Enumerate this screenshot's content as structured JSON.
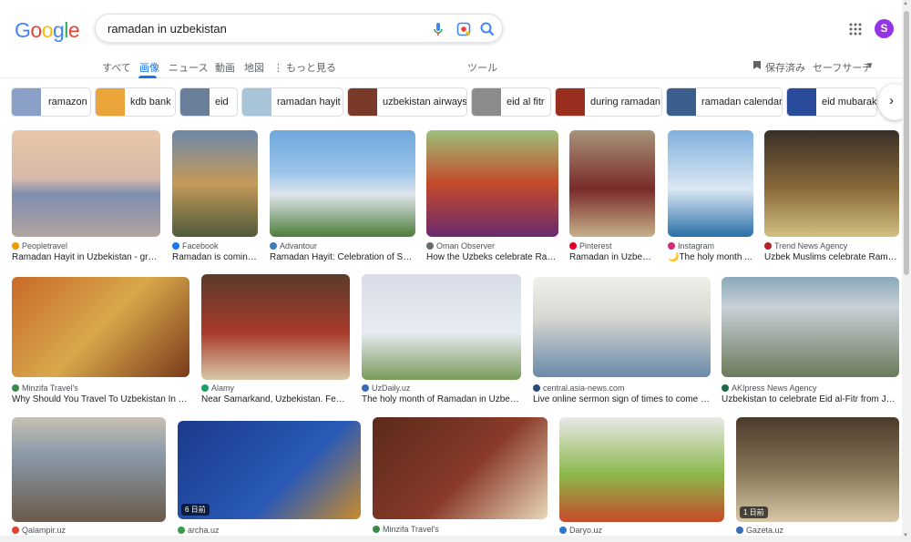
{
  "search": {
    "query": "ramadan in uzbekistan"
  },
  "account": {
    "initial": "S"
  },
  "tabs": [
    {
      "label": "すべて"
    },
    {
      "label": "画像"
    },
    {
      "label": "ニュース"
    },
    {
      "label": "動画"
    },
    {
      "label": "地図"
    },
    {
      "label": "⋮ もっと見る"
    }
  ],
  "tools_label": "ツール",
  "saved_label": "保存済み",
  "safesearch_label": "セーフサーチ",
  "chips": [
    {
      "label": "ramazon",
      "color": "#8aa0c8"
    },
    {
      "label": "kdb bank",
      "color": "#e9a43a"
    },
    {
      "label": "eid",
      "color": "#6a7f9a"
    },
    {
      "label": "ramadan hayit",
      "color": "#a8c4d8"
    },
    {
      "label": "uzbekistan airways",
      "color": "#7a3a2a"
    },
    {
      "label": "eid al fitr",
      "color": "#8c8c8c"
    },
    {
      "label": "during ramadan",
      "color": "#9a2e1f"
    },
    {
      "label": "ramadan calendar",
      "color": "#3b5e8c"
    },
    {
      "label": "eid mubarak",
      "color": "#2a4a9a"
    }
  ],
  "results": [
    {
      "source": "Peopletravel",
      "title": "Ramadan Hayit in Uzbekistan - great...",
      "fav": "#f29900",
      "colors": [
        "#e8c7a8",
        "#7e8fb0",
        "#b4a3a0"
      ],
      "badge": ""
    },
    {
      "source": "Facebook",
      "title": "Ramadan is coming...",
      "fav": "#1877f2",
      "colors": [
        "#6c88a8",
        "#c49a5a",
        "#4f5a3a"
      ],
      "badge": ""
    },
    {
      "source": "Advantour",
      "title": "Ramadan Hayit: Celebration of Spiri...",
      "fav": "#3c7db8",
      "colors": [
        "#6fa8dc",
        "#dfe6ee",
        "#4e7d3a"
      ],
      "badge": ""
    },
    {
      "source": "Oman Observer",
      "title": "How the Uzbeks celebrate Ram...",
      "fav": "#6b6b6b",
      "colors": [
        "#9cbf7a",
        "#6a2a6e",
        "#c44a2a"
      ],
      "badge": ""
    },
    {
      "source": "Pinterest",
      "title": "Ramadan in Uzbeki...",
      "fav": "#e60023",
      "colors": [
        "#a8947a",
        "#7a2a2a",
        "#c6b08a"
      ],
      "badge": ""
    },
    {
      "source": "Instagram",
      "title": "🌙The holy month ...",
      "fav": "#d62976",
      "colors": [
        "#7fb0dc",
        "#dce8f4",
        "#2a6ea8"
      ],
      "badge": ""
    },
    {
      "source": "Trend News Agency",
      "title": "Uzbek Muslims celebrate Ramad...",
      "fav": "#b22222",
      "colors": [
        "#3a3028",
        "#8a6a3a",
        "#d0c080"
      ],
      "badge": ""
    },
    {
      "source": "Minzifa Travel's",
      "title": "Why Should You Travel To Uzbekistan In Thi...",
      "fav": "#3a8a4a",
      "colors": [
        "#c86a2a",
        "#d8a84a",
        "#7a3a1a"
      ],
      "badge": ""
    },
    {
      "source": "Alamy",
      "title": "Near Samarkand, Uzbekistan. Feast ...",
      "fav": "#1aa260",
      "colors": [
        "#5a3a2a",
        "#a83a2a",
        "#d8c8a8"
      ],
      "badge": ""
    },
    {
      "source": "UzDaily.uz",
      "title": "The holy month of Ramadan in Uzbekis...",
      "fav": "#3a6ab8",
      "colors": [
        "#d8dce6",
        "#e8ecf4",
        "#7a9a5a"
      ],
      "badge": ""
    },
    {
      "source": "central.asia-news.com",
      "title": "Live online sermon sign of times to come in ...",
      "fav": "#2a4a7a",
      "colors": [
        "#d8d8d0",
        "#6a8aaa",
        "#f0f0ea"
      ],
      "badge": ""
    },
    {
      "source": "AKIpress News Agency",
      "title": "Uzbekistan to celebrate Eid al-Fitr from Jun...",
      "fav": "#1a6a4a",
      "colors": [
        "#8aa8b8",
        "#6a7a5a",
        "#c8d0d8"
      ],
      "badge": ""
    },
    {
      "source": "Qalampir.uz",
      "title": "",
      "fav": "#e0442a",
      "colors": [
        "#8a9aaa",
        "#6a5a4a",
        "#c8c0b0"
      ],
      "badge": ""
    },
    {
      "source": "archa.uz",
      "title": "",
      "fav": "#3a9a4a",
      "colors": [
        "#1a3a8a",
        "#2a5ab8",
        "#c88a2a"
      ],
      "badge": "6 日前"
    },
    {
      "source": "Minzifa Travel's",
      "title": "",
      "fav": "#3a8a4a",
      "colors": [
        "#5a2a1a",
        "#8a3a2a",
        "#e8d8b8"
      ],
      "badge": ""
    },
    {
      "source": "Daryo.uz",
      "title": "",
      "fav": "#2a7ac8",
      "colors": [
        "#e8e8e8",
        "#8ab84a",
        "#c84a2a"
      ],
      "badge": ""
    },
    {
      "source": "Gazeta.uz",
      "title": "",
      "fav": "#3a6ab8",
      "colors": [
        "#4a3a2a",
        "#8a7a5a",
        "#d8c8a8"
      ],
      "badge": "1 日前"
    }
  ]
}
